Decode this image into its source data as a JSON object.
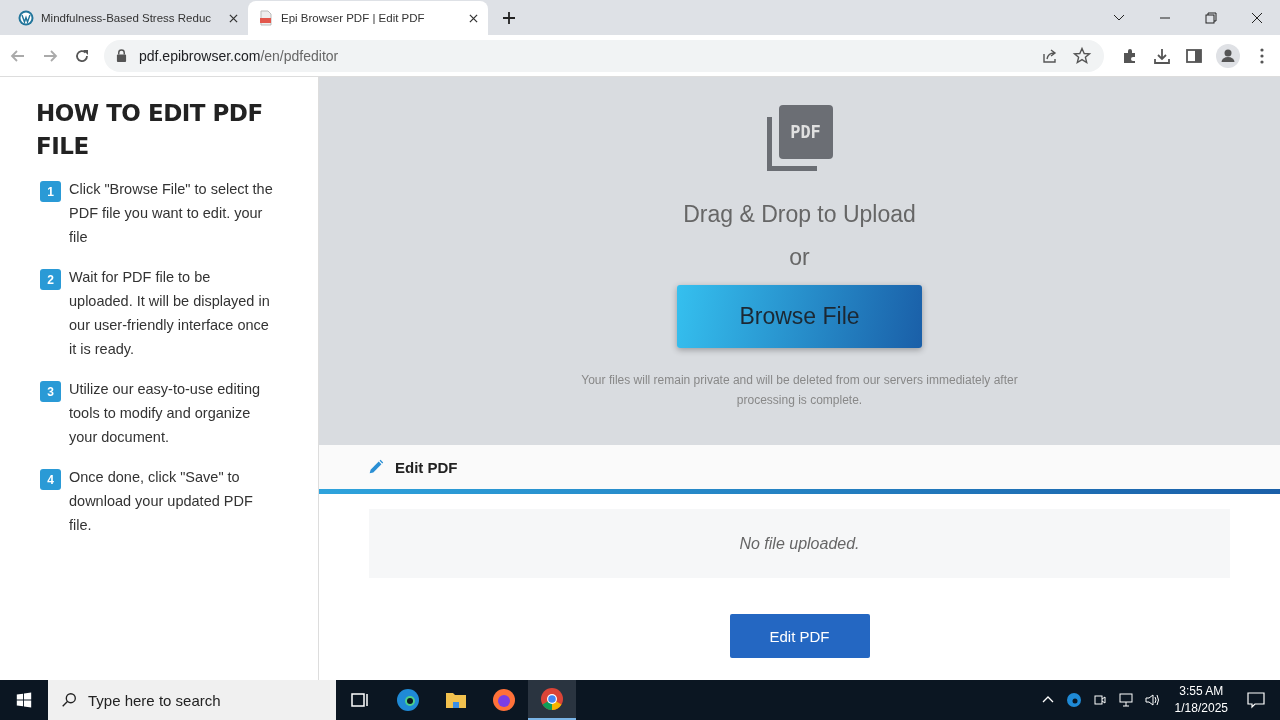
{
  "browser": {
    "tabs": [
      {
        "title": "Mindfulness-Based Stress Reduc",
        "selected": false,
        "kind": "wordpress"
      },
      {
        "title": "Epi Browser PDF | Edit PDF",
        "selected": true,
        "kind": "pdf"
      }
    ],
    "address": {
      "host": "pdf.epibrowser.com",
      "path": "/en/pdfeditor"
    }
  },
  "guide": {
    "title": "HOW TO EDIT PDF FILE",
    "steps": [
      {
        "number": "1",
        "text": "Click \"Browse File\" to select the PDF file you want to edit. your file"
      },
      {
        "number": "2",
        "text": "Wait for PDF file to be uploaded. It will be displayed in our user-friendly interface once it is ready."
      },
      {
        "number": "3",
        "text": "Utilize our easy-to-use editing tools to modify and organize your document."
      },
      {
        "number": "4",
        "text": "Once done, click \"Save\" to download your updated PDF file."
      }
    ]
  },
  "upload": {
    "icon_text": "PDF",
    "heading": "Drag & Drop to Upload",
    "or": "or",
    "button": "Browse File",
    "note": "Your files will remain private and will be deleted from our servers immediately after processing is complete."
  },
  "editor": {
    "title": "Edit PDF",
    "empty_message": "No file uploaded.",
    "button": "Edit PDF"
  },
  "taskbar": {
    "search": {
      "placeholder": "Type here to search"
    },
    "apps": [
      {
        "kind": "taskview",
        "selected": false
      },
      {
        "kind": "edge",
        "selected": false
      },
      {
        "kind": "explorer",
        "selected": false
      },
      {
        "kind": "firefox",
        "selected": false
      },
      {
        "kind": "chrome",
        "selected": true
      }
    ],
    "time": "3:55 AM",
    "date": "1/18/2025"
  }
}
